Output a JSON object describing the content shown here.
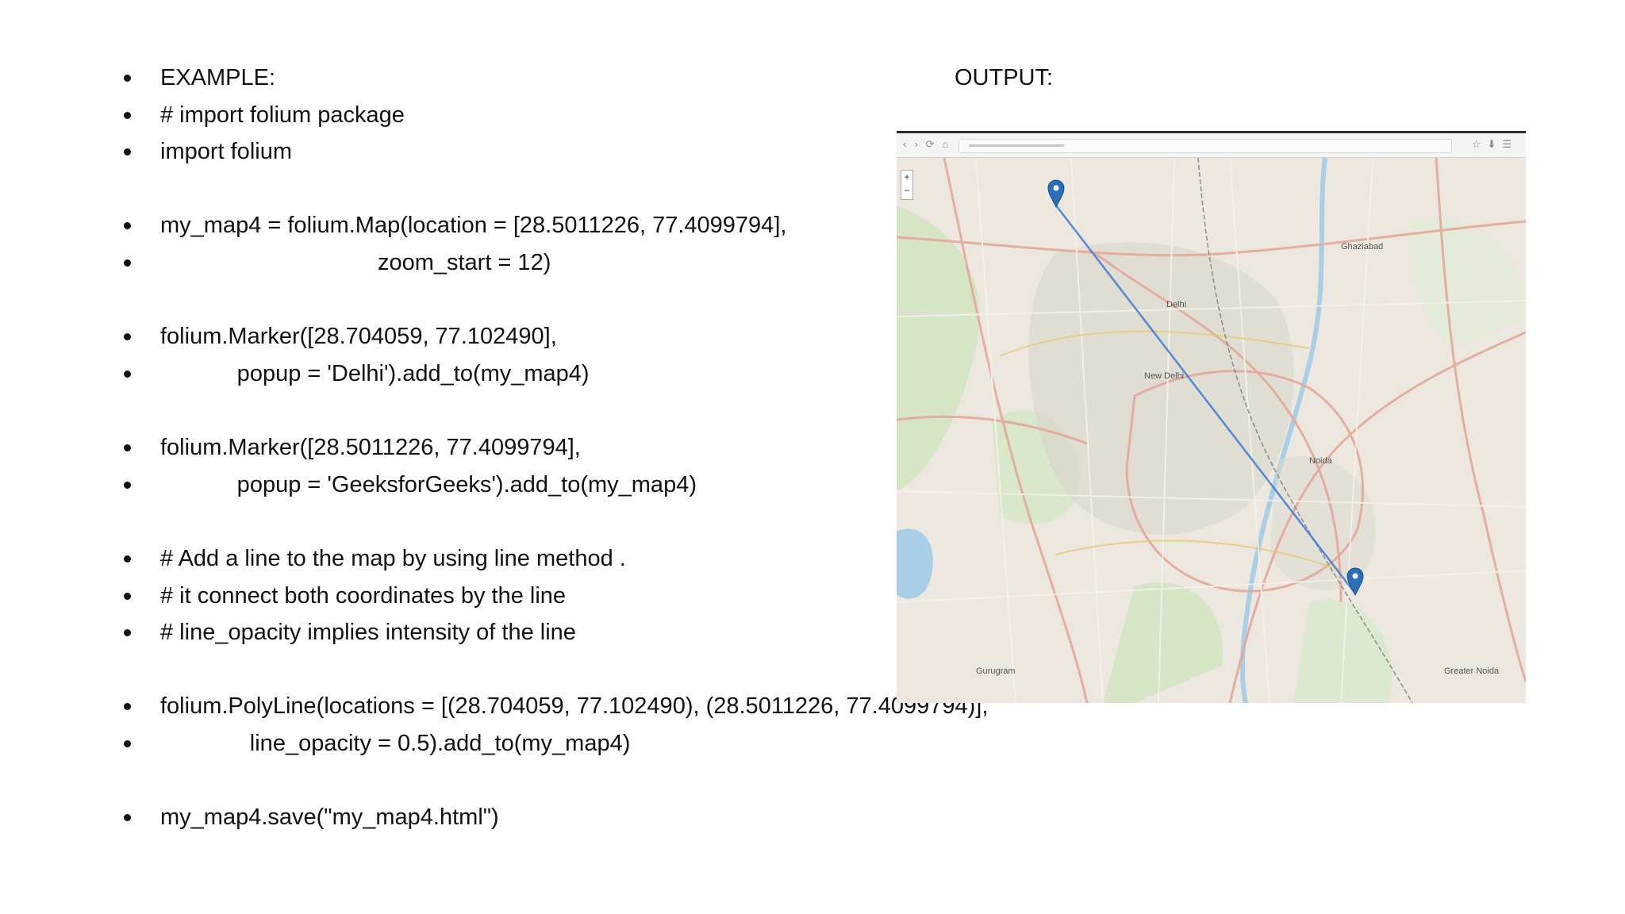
{
  "lines": [
    {
      "text": "EXAMPLE:"
    },
    {
      "text": "# import folium package"
    },
    {
      "text": "import folium"
    },
    {
      "text": "my_map4 = folium.Map(location = [28.5011226, 77.4099794],"
    },
    {
      "text": "                                  zoom_start = 12)"
    },
    {
      "text": "folium.Marker([28.704059, 77.102490],"
    },
    {
      "text": "            popup = 'Delhi').add_to(my_map4)"
    },
    {
      "text": "folium.Marker([28.5011226, 77.4099794],"
    },
    {
      "text": "            popup = 'GeeksforGeeks').add_to(my_map4)"
    },
    {
      "text": "# Add a line to the map by using line method ."
    },
    {
      "text": "# it connect both coordinates by the line"
    },
    {
      "text": "# line_opacity implies intensity of the line"
    },
    {
      "text": "folium.PolyLine(locations = [(28.704059, 77.102490), (28.5011226, 77.4099794)],"
    },
    {
      "text": "              line_opacity = 0.5).add_to(my_map4)"
    },
    {
      "text": "my_map4.save(\"my_map4.html\")"
    }
  ],
  "output_label": "OUTPUT:",
  "map": {
    "map_labels": [
      "New Delhi",
      "Delhi",
      "Ghaziabad",
      "Noida",
      "Gurugram",
      "Greater Noida"
    ],
    "line_color": "#3a7bd5",
    "marker_color": "#2a6fb8",
    "zoom_in": "+",
    "zoom_out": "−"
  }
}
